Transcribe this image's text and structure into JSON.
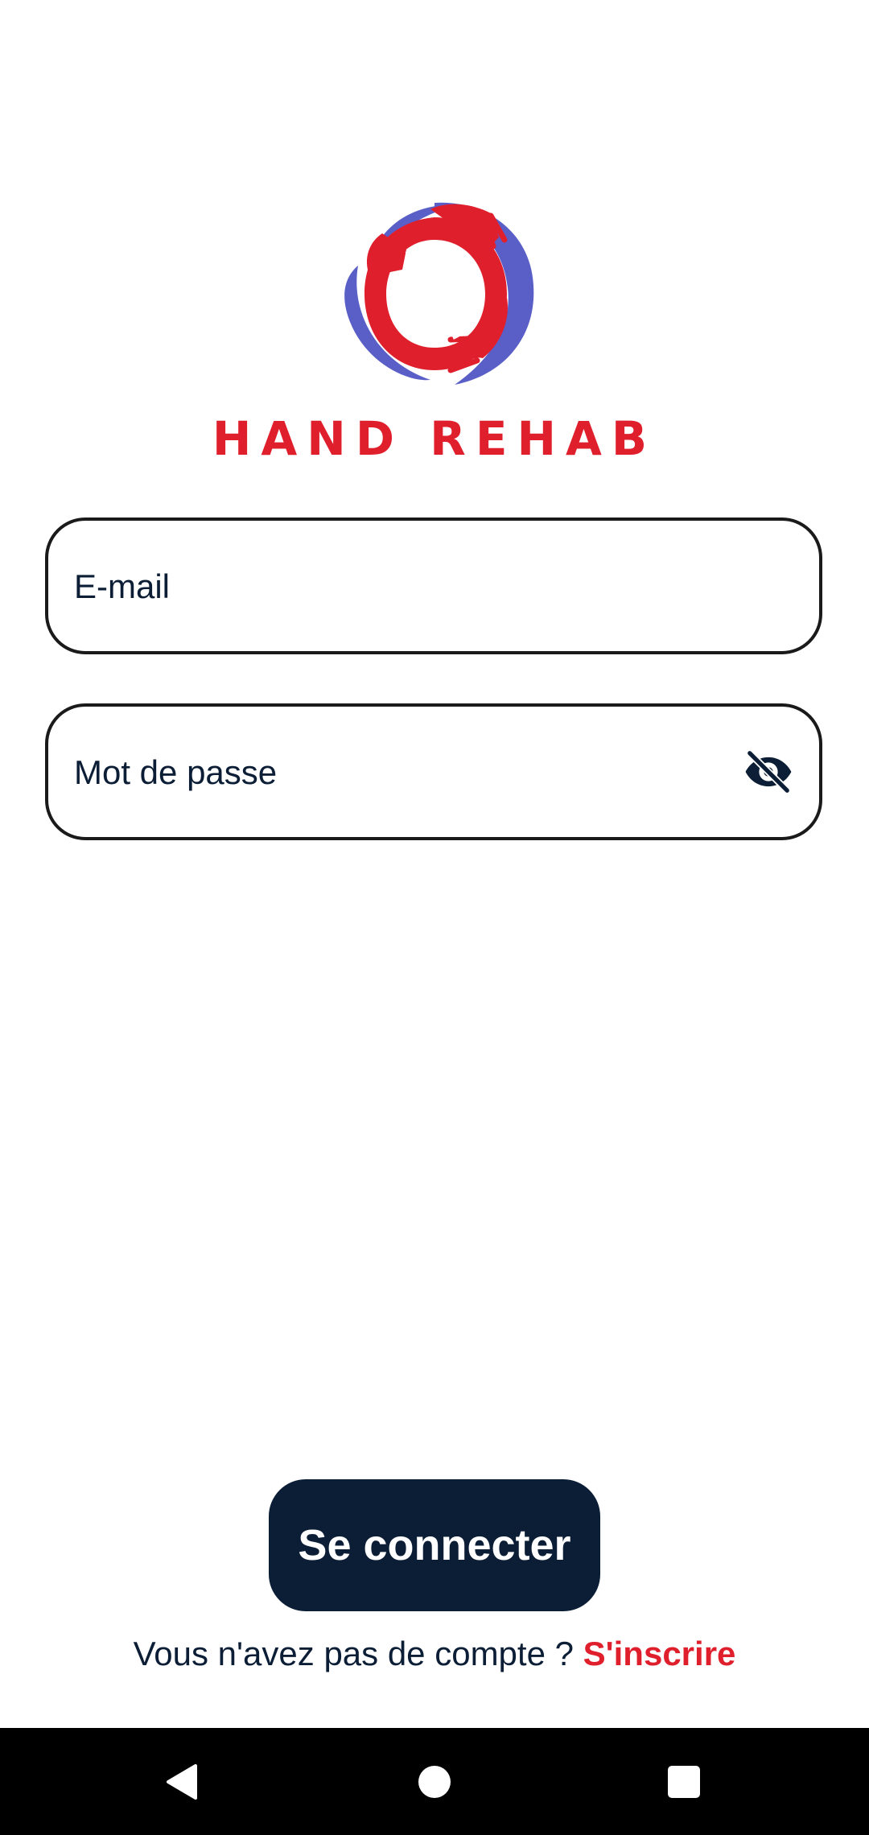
{
  "brand": {
    "name": "HAND REHAB",
    "colors": {
      "primary_red": "#e01f2d",
      "accent_blue": "#5a5fc8",
      "dark_navy": "#0c1e36"
    }
  },
  "form": {
    "email": {
      "placeholder": "E-mail",
      "value": ""
    },
    "password": {
      "placeholder": "Mot de passe",
      "value": "",
      "toggle_icon": "eye-off-icon"
    }
  },
  "actions": {
    "login_label": "Se connecter",
    "signup_prompt": "Vous n'avez pas de compte ? ",
    "signup_link": "S'inscrire"
  },
  "navbar": {
    "icons": [
      "back-triangle-icon",
      "home-circle-icon",
      "recents-square-icon"
    ]
  }
}
